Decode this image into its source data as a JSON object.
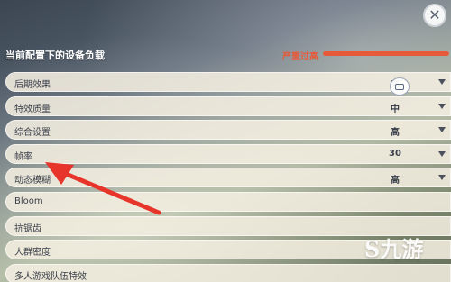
{
  "header": {
    "title": "当前配置下的设备负载",
    "load_status": "严重过高",
    "load_level": 1.0,
    "load_color": "#e65a3a"
  },
  "controls": {
    "close_glyph": "✕"
  },
  "settings": {
    "rows": [
      {
        "label": "后期效果",
        "value": "高",
        "has_dropdown": true
      },
      {
        "label": "特效质量",
        "value": "中",
        "has_dropdown": true
      },
      {
        "label": "综合设置",
        "value": "高",
        "has_dropdown": true
      },
      {
        "label": "帧率",
        "value": "30",
        "has_dropdown": true
      },
      {
        "label": "动态模糊",
        "value": "高",
        "has_dropdown": true
      },
      {
        "label": "Bloom",
        "value": "",
        "has_dropdown": false
      },
      {
        "label": "抗锯齿",
        "value": "",
        "has_dropdown": false
      },
      {
        "label": "人群密度",
        "value": "",
        "has_dropdown": false
      },
      {
        "label": "多人游戏队伍特效",
        "value": "",
        "has_dropdown": false
      }
    ]
  },
  "annotation": {
    "arrow_color": "#e8352b",
    "target": "帧率"
  },
  "watermark": {
    "text": "九游",
    "logo_glyph": "S"
  }
}
